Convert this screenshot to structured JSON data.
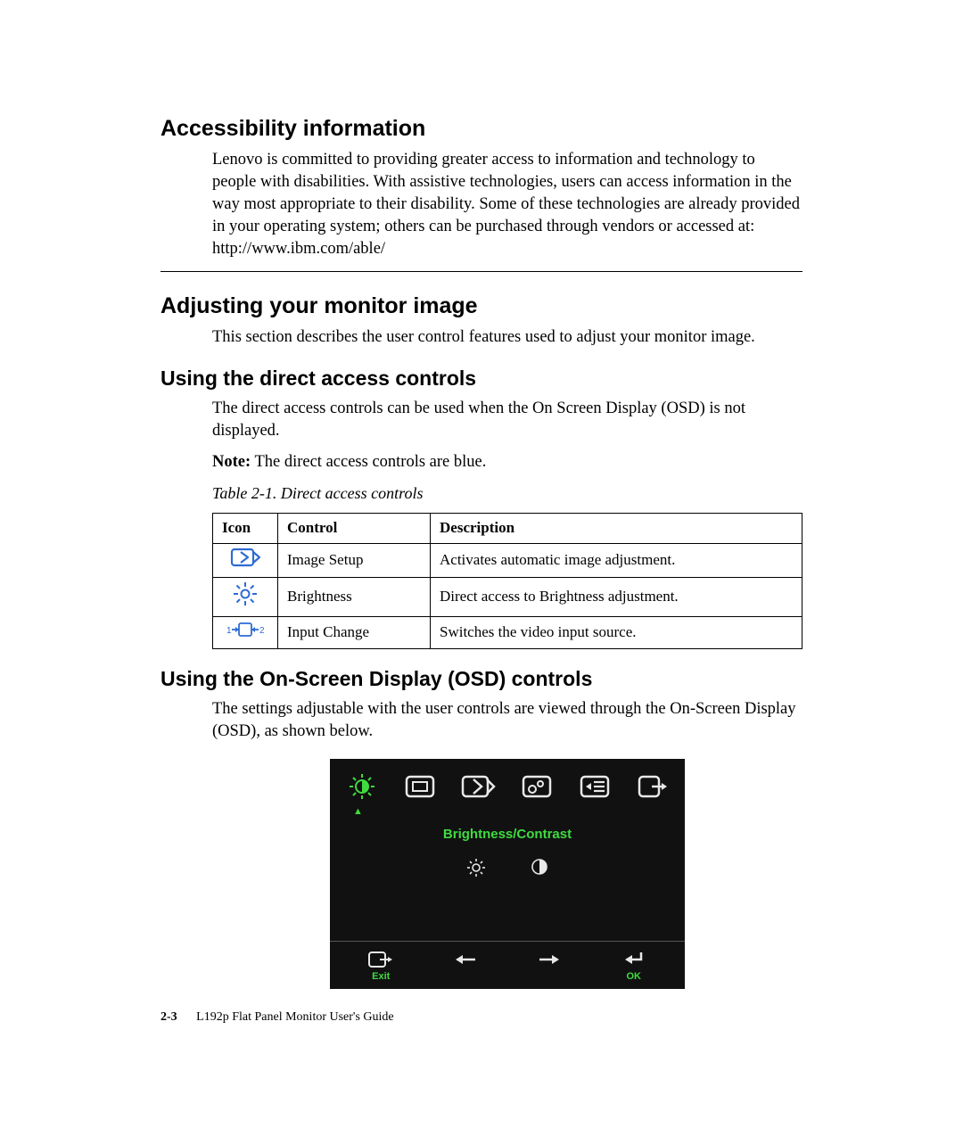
{
  "sections": {
    "accessibility": {
      "title": "Accessibility information",
      "body": "Lenovo is committed to providing greater access to information and technology to people with disabilities. With assistive technologies, users can access information in the way most appropriate to their disability. Some of these technologies are already provided in your operating system; others can be purchased through vendors or accessed at: http://www.ibm.com/able/"
    },
    "adjusting": {
      "title": "Adjusting your monitor image",
      "body": "This section describes the user control features used to adjust your monitor image."
    },
    "direct": {
      "title": "Using the direct access controls",
      "body": "The direct access controls can be used when the On Screen Display (OSD) is not displayed.",
      "note_label": "Note:",
      "note_text": " The direct access controls are blue.",
      "table_caption": "Table 2-1. Direct access controls",
      "headers": {
        "icon": "Icon",
        "control": "Control",
        "desc": "Description"
      },
      "rows": [
        {
          "icon": "image-setup-icon",
          "control": "Image Setup",
          "desc": "Activates automatic image adjustment."
        },
        {
          "icon": "brightness-icon",
          "control": "Brightness",
          "desc": "Direct access to Brightness adjustment."
        },
        {
          "icon": "input-change-icon",
          "control": "Input Change",
          "desc": "Switches the video input source."
        }
      ]
    },
    "osd": {
      "title": "Using the On-Screen Display (OSD) controls",
      "body": "The settings adjustable with the user controls are viewed through the On-Screen Display (OSD), as shown below.",
      "panel": {
        "menu_title": "Brightness/Contrast",
        "exit_label": "Exit",
        "ok_label": "OK"
      }
    }
  },
  "footer": {
    "page": "2-3",
    "book": "L192p Flat Panel Monitor User's Guide"
  }
}
